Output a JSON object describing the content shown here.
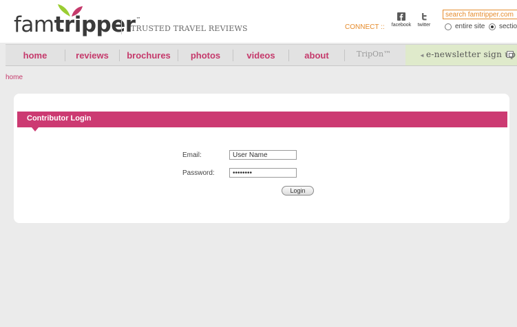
{
  "header": {
    "logo_regular": "fam",
    "logo_bold": "tripper",
    "logo_tm": "™",
    "tagline": "TRUSTED TRAVEL REVIEWS",
    "connect_label": "CONNECT ::",
    "social": [
      {
        "label": "facebook",
        "icon": "facebook-icon"
      },
      {
        "label": "twitter",
        "icon": "twitter-icon"
      }
    ],
    "search": {
      "value": "search famtripper.com"
    },
    "scope_options": [
      {
        "label": "entire site",
        "selected": false
      },
      {
        "label": "sectio",
        "selected": true
      }
    ]
  },
  "nav": {
    "items": [
      "home",
      "reviews",
      "brochures",
      "photos",
      "videos",
      "about"
    ],
    "tripon": "TripOn™",
    "newsletter": "e-newsletter sign up"
  },
  "breadcrumb": "home",
  "login": {
    "title": "Contributor Login",
    "email_label": "Email:",
    "email_value": "User Name",
    "password_label": "Password:",
    "password_value": "password",
    "button": "Login"
  },
  "colors": {
    "accent": "#c5396b",
    "bar": "#cc3a72",
    "connect": "#e58a2a",
    "newsletter_bg": "#dfeacb",
    "leaf_green": "#9acd32",
    "leaf_pink": "#c5396b"
  }
}
